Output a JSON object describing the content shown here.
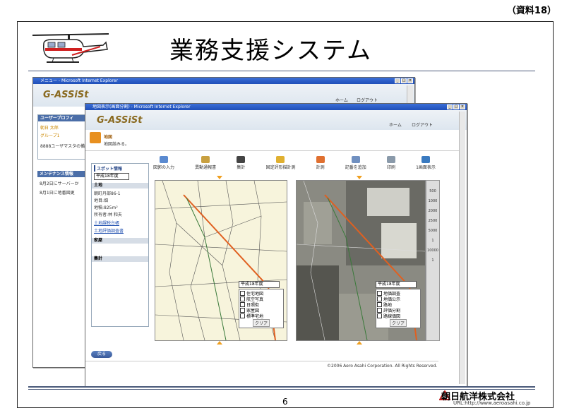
{
  "doc_label": "（資料18）",
  "slide_title": "業務支援システム",
  "page_number": "6",
  "company": {
    "name": "朝日航洋株式会社",
    "url": "URL:http://www.aeroasahi.co.jp"
  },
  "back_window": {
    "title": "メニュー - Microsoft Internet Explorer",
    "logo": "G-ASSiSt",
    "nav": {
      "home": "ホーム",
      "logout": "ログアウト"
    },
    "user_profile_header": "ユーザープロフィ",
    "user_name": "朝日 太郎",
    "user_group": "グループ1",
    "user_note": "8888ユーザマスタの備す。",
    "maintenance_header": "メンテナンス情報",
    "maintenance_items": [
      "8月2日にサーバーか",
      "8月1日に地番図更"
    ]
  },
  "front_window": {
    "title": "地図表示(画面分割) - Microsoft Internet Explorer",
    "logo": "G-ASSiSt",
    "nav": {
      "home": "ホーム",
      "logout": "ログアウト"
    },
    "page_heading": "地図",
    "page_sub": "地図該みる。",
    "toolbar": [
      "図郭の入力",
      "異動通報書",
      "集計",
      "固定評形描計測",
      "計測",
      "記番を追加",
      "印刷",
      "1画面表示"
    ],
    "sidebar": {
      "header": "スポット情報",
      "year_select": "平成18年度",
      "land_label": "土地",
      "land_lines": [
        "朝町丹部86-1",
        "地目:畑",
        "地積:825m²",
        "所有者:林 和夫"
      ],
      "links": [
        "土地課税台帳",
        "土地評価調査書"
      ],
      "house_label": "家屋",
      "aggregate_label": "集計"
    },
    "left_map_panel": {
      "year_select": "平成18年度",
      "layers": [
        "住宅地図",
        "航空写真",
        "日照街",
        "家屋図",
        "標準宅地"
      ],
      "clear": "クリア"
    },
    "right_map_panel": {
      "year_select": "平成18年度",
      "layers": [
        "地価調査",
        "地価公示",
        "路地",
        "評価分割",
        "路線価図"
      ],
      "clear": "クリア"
    },
    "scale_labels": [
      "500",
      "1000",
      "2000",
      "2500",
      "5000",
      "1",
      "10000",
      "1"
    ],
    "back_button": "戻る",
    "copyright": "©2006 Aero Asahi Corporation. All Rights Reserved."
  },
  "colors": {
    "accent_blue": "#4b6ea8",
    "map_bg": "#f7f4dc",
    "title_bar": "#2a5cc8"
  }
}
